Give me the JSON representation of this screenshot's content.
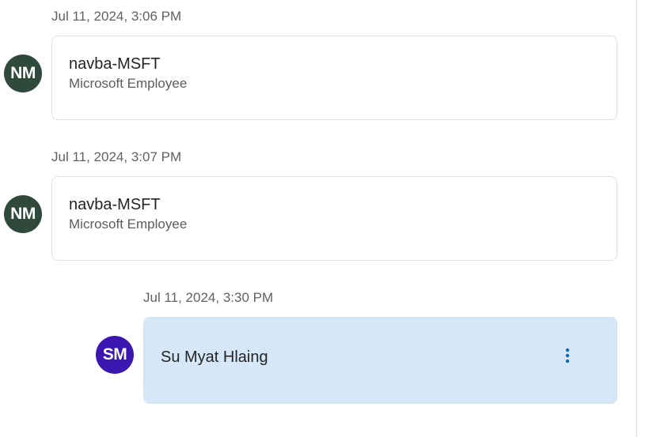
{
  "colors": {
    "avatar_nm": "#2f4a3c",
    "avatar_sm": "#3b16b0",
    "highlight_card_bg": "#d6e8f7",
    "more_icon": "#0f6cbd"
  },
  "messages": [
    {
      "timestamp": "Jul 11, 2024, 3:06 PM",
      "avatar_initials": "NM",
      "author": "navba-MSFT",
      "role": "Microsoft Employee"
    },
    {
      "timestamp": "Jul 11, 2024, 3:07 PM",
      "avatar_initials": "NM",
      "author": "navba-MSFT",
      "role": "Microsoft Employee"
    },
    {
      "timestamp": "Jul 11, 2024, 3:30 PM",
      "avatar_initials": "SM",
      "author": "Su Myat Hlaing",
      "more_icon": "more-vertical-icon"
    }
  ]
}
